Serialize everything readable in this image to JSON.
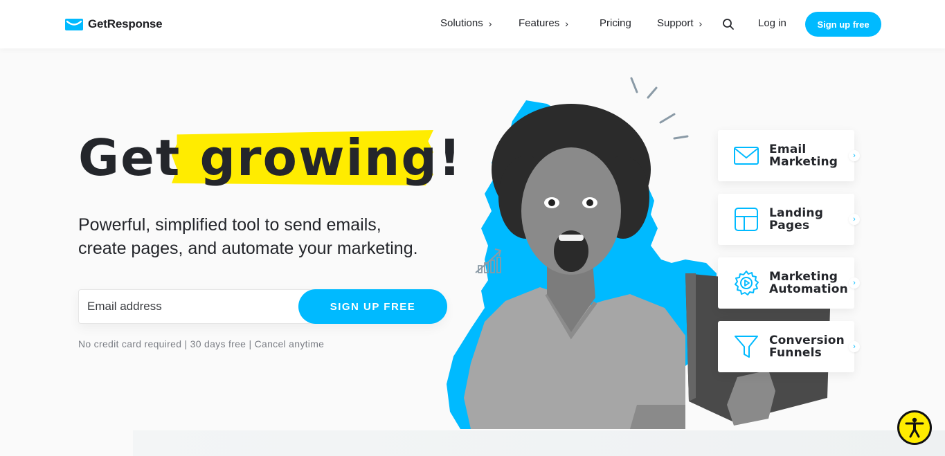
{
  "header": {
    "logo_text": "GetResponse",
    "nav": [
      {
        "label": "Solutions",
        "has_chevron": true
      },
      {
        "label": "Features",
        "has_chevron": true
      },
      {
        "label": "Pricing",
        "has_chevron": false
      },
      {
        "label": "Support",
        "has_chevron": true
      }
    ],
    "search_icon": "search-icon",
    "login_label": "Log in",
    "signup_label": "Sign up free"
  },
  "hero": {
    "title_word_1": "Get",
    "title_word_2": "growing!",
    "subtitle_line_1": "Powerful, simplified tool to send emails,",
    "subtitle_line_2": "create pages, and automate your marketing.",
    "email_placeholder": "Email address",
    "cta_label": "SIGN UP FREE",
    "disclaimer": "No credit card required | 30 days free | Cancel anytime"
  },
  "features": [
    {
      "line_1": "Email",
      "line_2": "Marketing",
      "icon": "envelope-icon"
    },
    {
      "line_1": "Landing",
      "line_2": "Pages",
      "icon": "layout-icon"
    },
    {
      "line_1": "Marketing",
      "line_2": "Automation",
      "icon": "gear-play-icon"
    },
    {
      "line_1": "Conversion",
      "line_2": "Funnels",
      "icon": "funnel-icon"
    }
  ],
  "accessibility_icon": "accessibility-icon",
  "colors": {
    "accent": "#00baff",
    "highlight": "#ffec00",
    "text": "#24262b"
  }
}
